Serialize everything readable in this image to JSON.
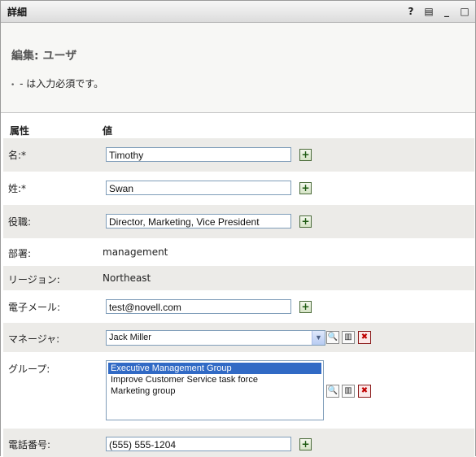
{
  "portlet": {
    "title": "詳細"
  },
  "toolbar": {
    "help": "?",
    "print": "▤",
    "minimize": "_",
    "maximize": "□"
  },
  "form": {
    "heading": "編集: ユーザ",
    "required_bullet": "•",
    "required_note": " - は入力必須です。",
    "col_attr": "属性",
    "col_value": "値"
  },
  "fields": {
    "first_name": {
      "label": "名:*",
      "value": "Timothy"
    },
    "last_name": {
      "label": "姓:*",
      "value": "Swan"
    },
    "title": {
      "label": "役職:",
      "value": "Director, Marketing, Vice President"
    },
    "department": {
      "label": "部署:",
      "value": "management"
    },
    "region": {
      "label": "リージョン:",
      "value": "Northeast"
    },
    "email": {
      "label": "電子メール:",
      "value": "test@novell.com"
    },
    "manager": {
      "label": "マネージャ:",
      "value": "Jack Miller"
    },
    "groups": {
      "label": "グループ:",
      "options": [
        "Executive Management Group",
        "Improve Customer Service task force",
        "Marketing group"
      ],
      "selected": "Executive Management Group"
    },
    "phone": {
      "label": "電話番号:",
      "value": "(555) 555-1204"
    }
  },
  "buttons": {
    "add": "+",
    "search": "🔍",
    "history": "▥",
    "remove": "✖"
  }
}
